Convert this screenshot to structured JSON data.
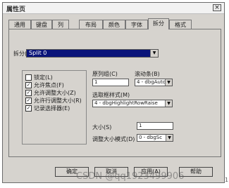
{
  "window": {
    "title": "属性页",
    "close": "×"
  },
  "tabs": [
    {
      "label": "通用"
    },
    {
      "label": "键盘"
    },
    {
      "label": "列"
    },
    {
      "label": "布局"
    },
    {
      "label": "颜色"
    },
    {
      "label": "字体"
    },
    {
      "label": "拆分"
    },
    {
      "label": "格式"
    }
  ],
  "active_tab": "拆分",
  "split": {
    "label": "拆分(S)",
    "value": "Split 0"
  },
  "checkboxes": [
    {
      "label": "锁定(L)",
      "checked": false
    },
    {
      "label": "允许焦点(F)",
      "checked": true
    },
    {
      "label": "允许调整大小(Z)",
      "checked": true
    },
    {
      "label": "允许行调整大小(R)",
      "checked": true
    },
    {
      "label": "记录选择器(E)",
      "checked": true
    }
  ],
  "settings": {
    "fixed_cols_label": "原列组(C)",
    "fixed_cols_value": "1",
    "scrollbar_label": "滚动条(B)",
    "scrollbar_value": "4 - dbgAuto",
    "marquee_label": "选取框样式(M)",
    "marquee_value": "4 - dbgHighlightRowRaise",
    "size_label": "大小(S)",
    "size_value": "1",
    "sizemode_label": "调整大小模式(D)",
    "sizemode_value": "0 - dbgSc"
  },
  "buttons": {
    "ok": "确定",
    "cancel": "取消",
    "apply": "应用(A)",
    "help": "帮助"
  },
  "watermark": "CSDN @qq1923499906",
  "side_mark": "1"
}
